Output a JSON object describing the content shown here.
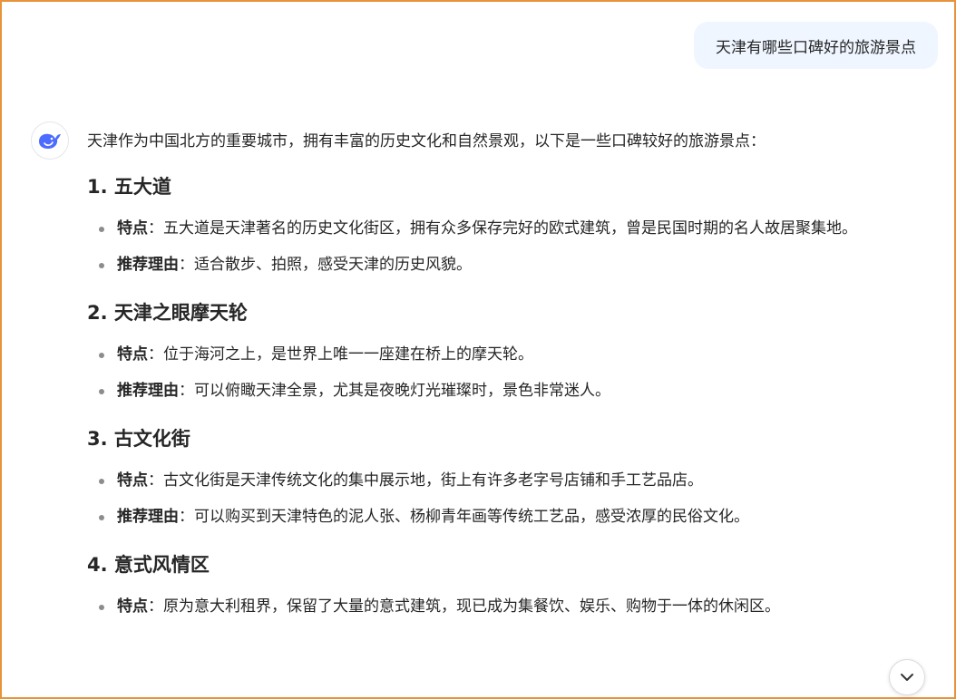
{
  "user_message": "天津有哪些口碑好的旅游景点",
  "assistant": {
    "intro": "天津作为中国北方的重要城市，拥有丰富的历史文化和自然景观，以下是一些口碑较好的旅游景点：",
    "sections": [
      {
        "title": "1. 五大道",
        "points": [
          {
            "label": "特点",
            "text": "：五大道是天津著名的历史文化街区，拥有众多保存完好的欧式建筑，曾是民国时期的名人故居聚集地。"
          },
          {
            "label": "推荐理由",
            "text": "：适合散步、拍照，感受天津的历史风貌。"
          }
        ]
      },
      {
        "title": "2. 天津之眼摩天轮",
        "points": [
          {
            "label": "特点",
            "text": "：位于海河之上，是世界上唯一一座建在桥上的摩天轮。"
          },
          {
            "label": "推荐理由",
            "text": "：可以俯瞰天津全景，尤其是夜晚灯光璀璨时，景色非常迷人。"
          }
        ]
      },
      {
        "title": "3. 古文化街",
        "points": [
          {
            "label": "特点",
            "text": "：古文化街是天津传统文化的集中展示地，街上有许多老字号店铺和手工艺品店。"
          },
          {
            "label": "推荐理由",
            "text": "：可以购买到天津特色的泥人张、杨柳青年画等传统工艺品，感受浓厚的民俗文化。"
          }
        ]
      },
      {
        "title": "4. 意式风情区",
        "points": [
          {
            "label": "特点",
            "text": "：原为意大利租界，保留了大量的意式建筑，现已成为集餐饮、娱乐、购物于一体的休闲区。"
          }
        ]
      }
    ]
  },
  "icons": {
    "avatar": "deepseek-whale-icon",
    "scroll": "chevron-down-icon"
  },
  "colors": {
    "frame_border": "#e8923a",
    "user_bubble_bg": "#eff6ff",
    "brand": "#4d6bfe"
  }
}
